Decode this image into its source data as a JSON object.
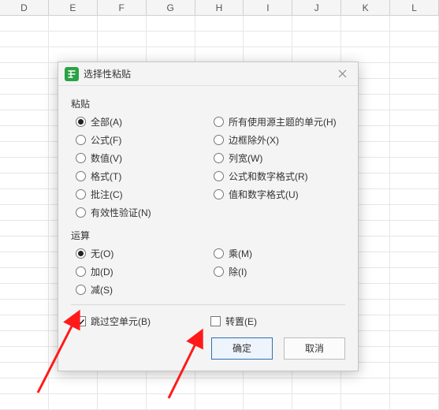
{
  "columns": [
    "D",
    "E",
    "F",
    "G",
    "H",
    "I",
    "J",
    "K",
    "L"
  ],
  "row_count": 25,
  "dialog": {
    "title": "选择性粘贴",
    "section_paste": "粘贴",
    "paste_options": {
      "all": "全部(A)",
      "formulas": "公式(F)",
      "values": "数值(V)",
      "formats": "格式(T)",
      "comments": "批注(C)",
      "validation": "有效性验证(N)",
      "theme": "所有使用源主题的单元(H)",
      "noborder": "边框除外(X)",
      "colwidth": "列宽(W)",
      "numfmt": "公式和数字格式(R)",
      "valfmt": "值和数字格式(U)"
    },
    "section_op": "运算",
    "op_options": {
      "none": "无(O)",
      "add": "加(D)",
      "sub": "减(S)",
      "mul": "乘(M)",
      "div": "除(I)"
    },
    "skip_blanks": "跳过空单元(B)",
    "transpose": "转置(E)",
    "ok": "确定",
    "cancel": "取消"
  }
}
